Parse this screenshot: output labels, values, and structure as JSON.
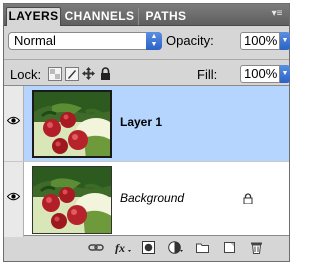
{
  "tabs": [
    {
      "label": "LAYERS",
      "active": true
    },
    {
      "label": "CHANNELS",
      "active": false
    },
    {
      "label": "PATHS",
      "active": false
    }
  ],
  "panel_menu_icon": "panel-menu-icon",
  "blend_mode": {
    "value": "Normal"
  },
  "opacity": {
    "label": "Opacity:",
    "value": "100%"
  },
  "lock": {
    "label": "Lock:",
    "icons": [
      "lock-transparent-pixels-icon",
      "lock-image-pixels-icon",
      "lock-position-icon",
      "lock-all-icon"
    ]
  },
  "fill": {
    "label": "Fill:",
    "value": "100%"
  },
  "layers": [
    {
      "name": "Layer 1",
      "selected": true,
      "visible": true,
      "locked": false
    },
    {
      "name": "Background",
      "selected": false,
      "visible": true,
      "locked": true
    }
  ],
  "bottom_icons": [
    "link-layers-icon",
    "layer-style-icon",
    "layer-mask-icon",
    "adjustment-layer-icon",
    "new-group-icon",
    "new-layer-icon",
    "delete-layer-icon"
  ],
  "colors": {
    "selection": "#b5d5ff",
    "panel_bg": "#d6d6d6",
    "accent": "#2a62c8"
  }
}
